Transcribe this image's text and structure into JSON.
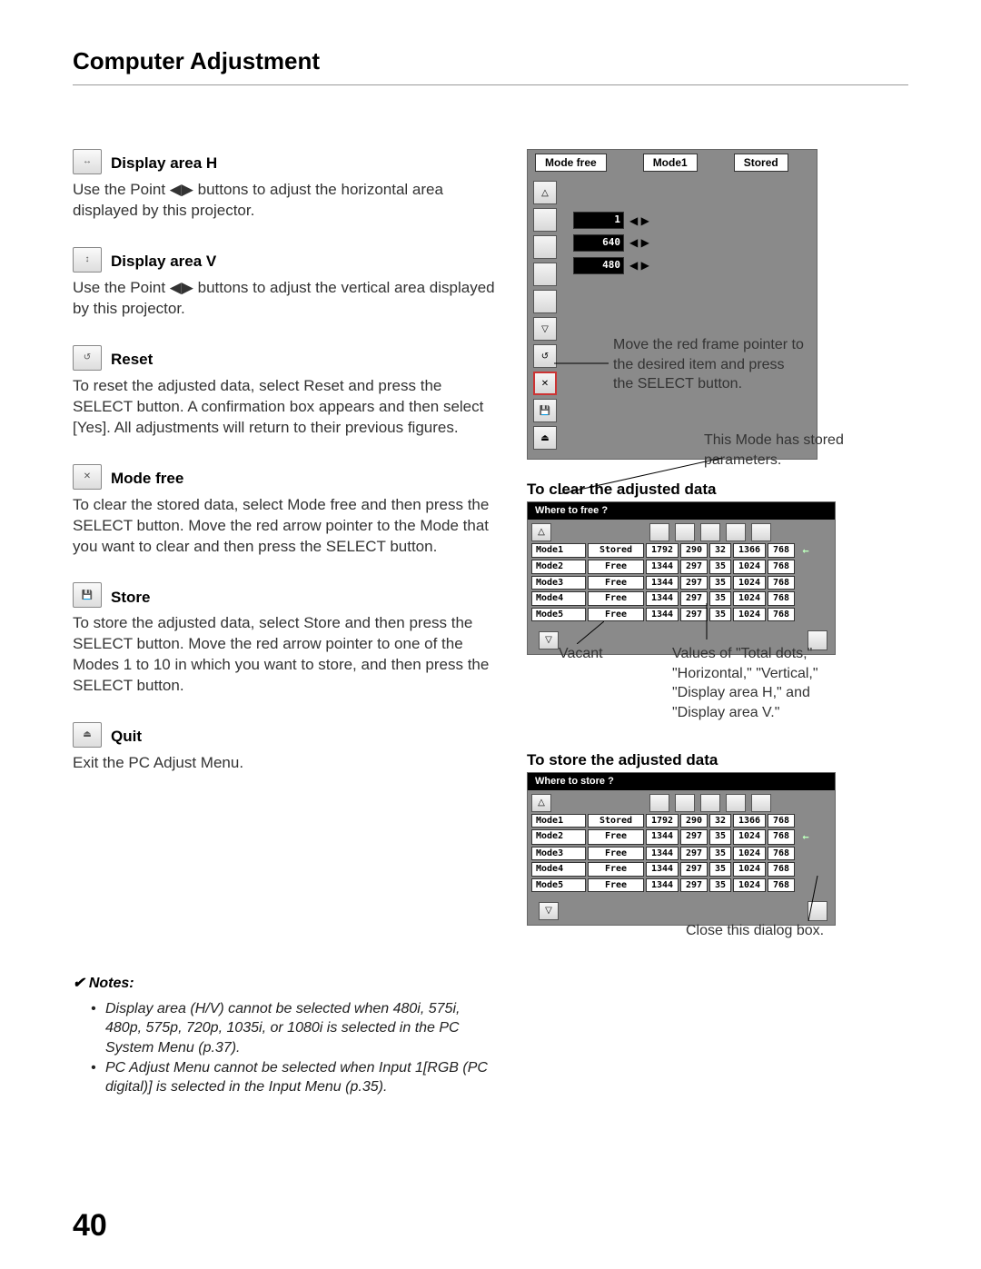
{
  "header": {
    "title": "Computer Adjustment"
  },
  "page_number": "40",
  "items": {
    "displayH": {
      "title": "Display area H",
      "body": "Use the Point ◀▶ buttons to adjust the horizontal area displayed by this projector."
    },
    "displayV": {
      "title": "Display area V",
      "body": "Use the Point ◀▶ buttons to adjust the vertical area displayed by this projector."
    },
    "reset": {
      "title": "Reset",
      "body": "To reset the adjusted data, select Reset and press the SELECT button. A confirmation box appears and then select [Yes]. All adjustments will return to their previous figures."
    },
    "modefree": {
      "title": "Mode free",
      "body": "To clear the stored data, select Mode free and then press the SELECT button. Move the red arrow pointer to the Mode that you want to clear and then press the SELECT button."
    },
    "store": {
      "title": "Store",
      "body": "To store the adjusted data, select Store and then press the SELECT button. Move the red arrow pointer to one of the Modes 1 to 10 in which you want to store, and then press the SELECT button."
    },
    "quit": {
      "title": "Quit",
      "body": "Exit the PC Adjust Menu."
    }
  },
  "notes": {
    "heading": "✔ Notes:",
    "n1": "Display area (H/V) cannot be selected when 480i, 575i, 480p, 575p, 720p, 1035i, or 1080i is selected in the PC System Menu (p.37).",
    "n2": "PC Adjust Menu cannot be selected when Input 1[RGB (PC digital)] is selected in the Input Menu (p.35)."
  },
  "osd1": {
    "title": "Mode free",
    "status1": "Mode1",
    "status2": "Stored",
    "values": {
      "v1": "1",
      "v2": "640",
      "v3": "480"
    },
    "callout": "Move the red frame pointer to the desired item and press the SELECT button."
  },
  "section_clear": {
    "label": "To clear the adjusted data"
  },
  "section_store": {
    "label": "To store the adjusted data"
  },
  "mode_callout": "This Mode has stored parameters.",
  "table_clear": {
    "header": "Where to free ?",
    "rows": [
      {
        "mode": "Mode1",
        "status": "Stored",
        "a": "1792",
        "b": "290",
        "c": "32",
        "d": "1366",
        "e": "768",
        "arrow": true
      },
      {
        "mode": "Mode2",
        "status": "Free",
        "a": "1344",
        "b": "297",
        "c": "35",
        "d": "1024",
        "e": "768"
      },
      {
        "mode": "Mode3",
        "status": "Free",
        "a": "1344",
        "b": "297",
        "c": "35",
        "d": "1024",
        "e": "768"
      },
      {
        "mode": "Mode4",
        "status": "Free",
        "a": "1344",
        "b": "297",
        "c": "35",
        "d": "1024",
        "e": "768"
      },
      {
        "mode": "Mode5",
        "status": "Free",
        "a": "1344",
        "b": "297",
        "c": "35",
        "d": "1024",
        "e": "768"
      }
    ],
    "below_left": "Vacant",
    "below_right": "Values of \"Total dots,\" \"Horizontal,\" \"Vertical,\" \"Display area H,\" and \"Display area V.\""
  },
  "table_store": {
    "header": "Where to store ?",
    "rows": [
      {
        "mode": "Mode1",
        "status": "Stored",
        "a": "1792",
        "b": "290",
        "c": "32",
        "d": "1366",
        "e": "768"
      },
      {
        "mode": "Mode2",
        "status": "Free",
        "a": "1344",
        "b": "297",
        "c": "35",
        "d": "1024",
        "e": "768",
        "arrow": true
      },
      {
        "mode": "Mode3",
        "status": "Free",
        "a": "1344",
        "b": "297",
        "c": "35",
        "d": "1024",
        "e": "768"
      },
      {
        "mode": "Mode4",
        "status": "Free",
        "a": "1344",
        "b": "297",
        "c": "35",
        "d": "1024",
        "e": "768"
      },
      {
        "mode": "Mode5",
        "status": "Free",
        "a": "1344",
        "b": "297",
        "c": "35",
        "d": "1024",
        "e": "768"
      }
    ],
    "below": "Close this dialog box."
  }
}
